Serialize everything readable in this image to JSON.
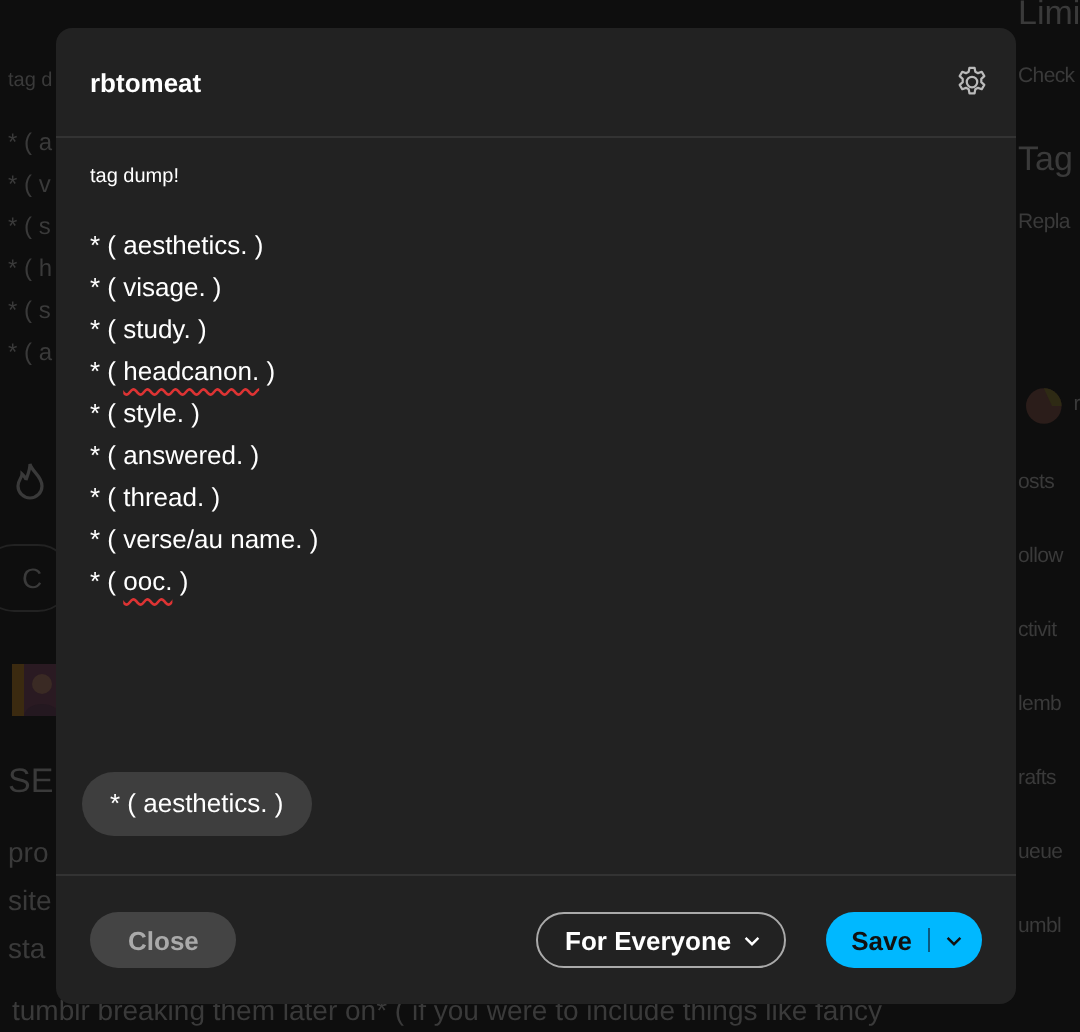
{
  "background": {
    "left": [
      {
        "kind": "text",
        "text": "tag d"
      },
      {
        "kind": "list",
        "text": "* ( a"
      },
      {
        "kind": "list",
        "text": "* ( v"
      },
      {
        "kind": "list",
        "text": "* ( s"
      },
      {
        "kind": "list",
        "text": "* ( h"
      },
      {
        "kind": "list",
        "text": "* ( s"
      },
      {
        "kind": "list",
        "text": "* ( a"
      },
      {
        "kind": "icon"
      },
      {
        "kind": "button",
        "text": "C"
      },
      {
        "kind": "picture"
      },
      {
        "kind": "heading",
        "text": "SE"
      },
      {
        "kind": "para",
        "text": "pro"
      },
      {
        "kind": "para",
        "text": "site"
      },
      {
        "kind": "para",
        "text": "sta"
      }
    ],
    "right": [
      {
        "kind": "heading",
        "text": "Limi"
      },
      {
        "kind": "text",
        "text": "Check"
      },
      {
        "kind": "heading",
        "text": "Tag"
      },
      {
        "kind": "text",
        "text": "Repla"
      },
      {
        "kind": "blog",
        "text": "r"
      },
      {
        "kind": "text",
        "text": "osts"
      },
      {
        "kind": "text",
        "text": "ollow"
      },
      {
        "kind": "text",
        "text": "ctivit"
      },
      {
        "kind": "text",
        "text": "lemb"
      },
      {
        "kind": "text",
        "text": "rafts"
      },
      {
        "kind": "text",
        "text": "ueue"
      },
      {
        "kind": "text",
        "text": "umbl"
      }
    ],
    "bottom_line": "tumblr breaking them later on* ( if you were to include things like fancy"
  },
  "modal": {
    "blog_name": "rbtomeat",
    "intro": "tag dump!",
    "lines": [
      {
        "text": "* ( aesthetics. )",
        "misspelled": false
      },
      {
        "text": "* ( visage. )",
        "misspelled": false
      },
      {
        "text": "* ( study. )",
        "misspelled": false
      },
      {
        "text": "* ( ",
        "word": "headcanon.",
        "after": " )",
        "misspelled": true
      },
      {
        "text": "* ( style. )",
        "misspelled": false
      },
      {
        "text": "* ( answered. )",
        "misspelled": false
      },
      {
        "text": "* ( thread. )",
        "misspelled": false
      },
      {
        "text": "* ( verse/au name. )",
        "misspelled": false
      },
      {
        "text": "* ( ",
        "word": "ooc.",
        "after": " )",
        "misspelled": true
      }
    ],
    "tags": [
      "* ( aesthetics. )"
    ],
    "close": "Close",
    "audience": "For Everyone",
    "save": "Save"
  }
}
